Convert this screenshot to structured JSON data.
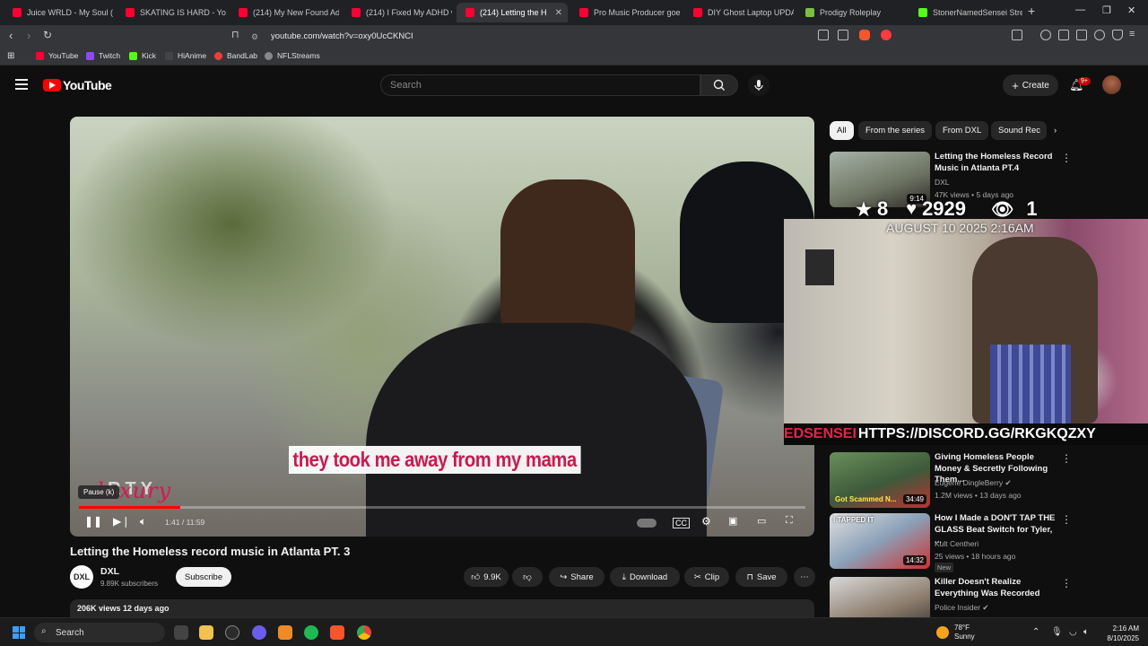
{
  "browser": {
    "tabs": [
      {
        "label": "Juice WRLD - My Soul (Un",
        "color": "#ff0033"
      },
      {
        "label": "SKATING IS HARD - YouTu",
        "color": "#ff0033"
      },
      {
        "label": "(214) My New Found Addi",
        "color": "#ff0033"
      },
      {
        "label": "(214) I Fixed My ADHD wi",
        "color": "#ff0033"
      },
      {
        "label": "(214) Letting the H",
        "color": "#ff0033",
        "active": true
      },
      {
        "label": "Pro Music Producer goes",
        "color": "#ff0033"
      },
      {
        "label": "DIY Ghost Laptop UPDATE",
        "color": "#ff0033"
      },
      {
        "label": "Prodigy Roleplay",
        "color": "#7bc043"
      },
      {
        "label": "StonerNamedSensei Strea",
        "color": "#53fc18"
      }
    ],
    "url": "youtube.com/watch?v=oxy0UcCKNCI",
    "bookmarks": [
      {
        "label": "YouTube",
        "color": "#ff0033"
      },
      {
        "label": "Twitch",
        "color": "#9146ff"
      },
      {
        "label": "Kick",
        "color": "#53fc18"
      },
      {
        "label": "HiAnime",
        "color": "#444444"
      },
      {
        "label": "BandLab",
        "color": "#f33b3b"
      },
      {
        "label": "NFLStreams",
        "color": "#888888"
      }
    ]
  },
  "header": {
    "logo": "YouTube",
    "search_placeholder": "Search",
    "create_label": "Create",
    "notif_count": "9+"
  },
  "player": {
    "subtitle": "they took me away from my mama",
    "brand_top": "RTY",
    "brand_script": "luxury",
    "tooltip": "Pause (k)",
    "time": "1:41 / 11:59",
    "progress": 0.14
  },
  "overlay": {
    "stars": "8",
    "likes": "2929",
    "viewers": "1",
    "timestamp": "AUGUST 10 2025 2:16AM",
    "discord_prefix": "EDSENSEI",
    "discord_url": "HTTPS://DISCORD.GG/RKGKQZXY"
  },
  "chips": [
    "All",
    "From the series",
    "From DXL",
    "Sound Rec"
  ],
  "recommendations": [
    {
      "title": "Letting the Homeless Record Music in Atlanta PT.4",
      "channel": "DXL",
      "meta": "47K views • 5 days ago",
      "duration": "9:14"
    },
    {
      "title": "Giving Homeless People Money & Secretly Following Them...",
      "channel": "Eugene DingleBerry",
      "meta": "1.2M views • 13 days ago",
      "duration": "34:49",
      "thumb_text": "Got Scammed N..."
    },
    {
      "title": "How I Made a DON'T TAP THE GLASS Beat Switch for Tyler, ...",
      "channel": "Kult Centheri",
      "meta": "25 views • 18 hours ago",
      "duration": "14:32",
      "badge": "New",
      "thumb_text": "I TAPPED IT"
    },
    {
      "title": "Killer Doesn't Realize Everything Was Recorded",
      "channel": "Police Insider",
      "meta": ""
    }
  ],
  "video": {
    "title": "Letting the Homeless record music in Atlanta PT. 3",
    "channel": "DXL",
    "subs": "9.89K subscribers",
    "subscribe": "Subscribe",
    "likes": "9.9K",
    "share": "Share",
    "download": "Download",
    "clip": "Clip",
    "save": "Save",
    "views_date": "206K views  12 days ago"
  },
  "taskbar": {
    "search": "Search",
    "temp": "78°F",
    "weather": "Sunny",
    "time": "2:16 AM",
    "date": "8/10/2025"
  }
}
